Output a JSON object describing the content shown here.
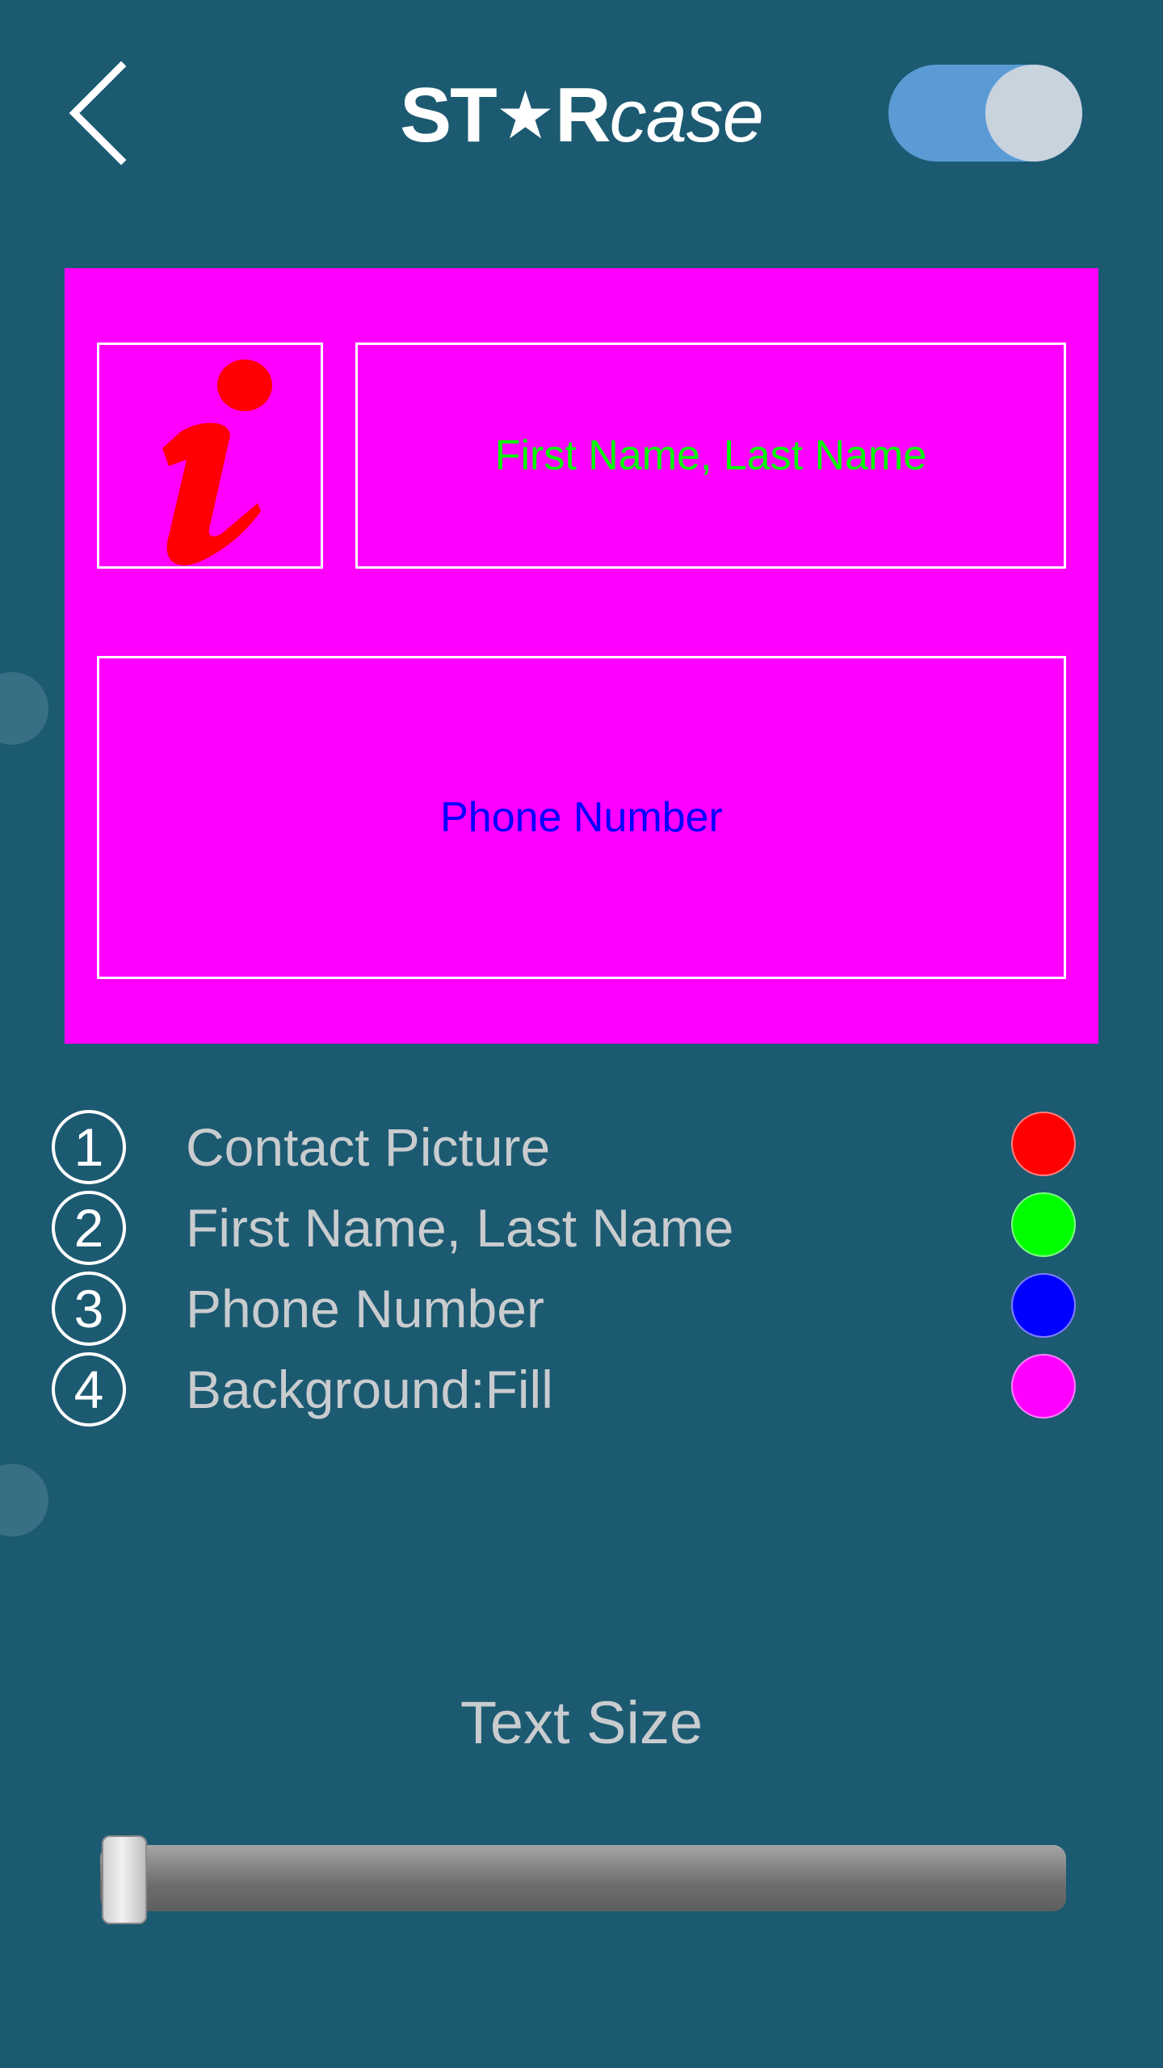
{
  "header": {
    "back_icon": "chevron-left-icon",
    "logo": {
      "bold_part_1": "ST",
      "star": "★",
      "bold_part_2": "R",
      "italic_part": "case"
    },
    "toggle": {
      "state": "on",
      "color": "#5a9bd6"
    }
  },
  "preview": {
    "background_color": "#ff00ff",
    "contact_picture_icon": "info-icon",
    "contact_picture_color": "#ff0000",
    "name_text": "First Name, Last Name",
    "name_color": "#00ff00",
    "phone_text": "Phone Number",
    "phone_color": "#0000ff"
  },
  "legend": [
    {
      "number": "1",
      "label": "Contact Picture",
      "color": "#ff0000"
    },
    {
      "number": "2",
      "label": "First Name, Last Name",
      "color": "#00ff00"
    },
    {
      "number": "3",
      "label": "Phone Number",
      "color": "#0000ff"
    },
    {
      "number": "4",
      "label": "Background:Fill",
      "color": "#ff00ff"
    }
  ],
  "text_size": {
    "title": "Text Size",
    "slider_value_fraction": 0.0
  }
}
